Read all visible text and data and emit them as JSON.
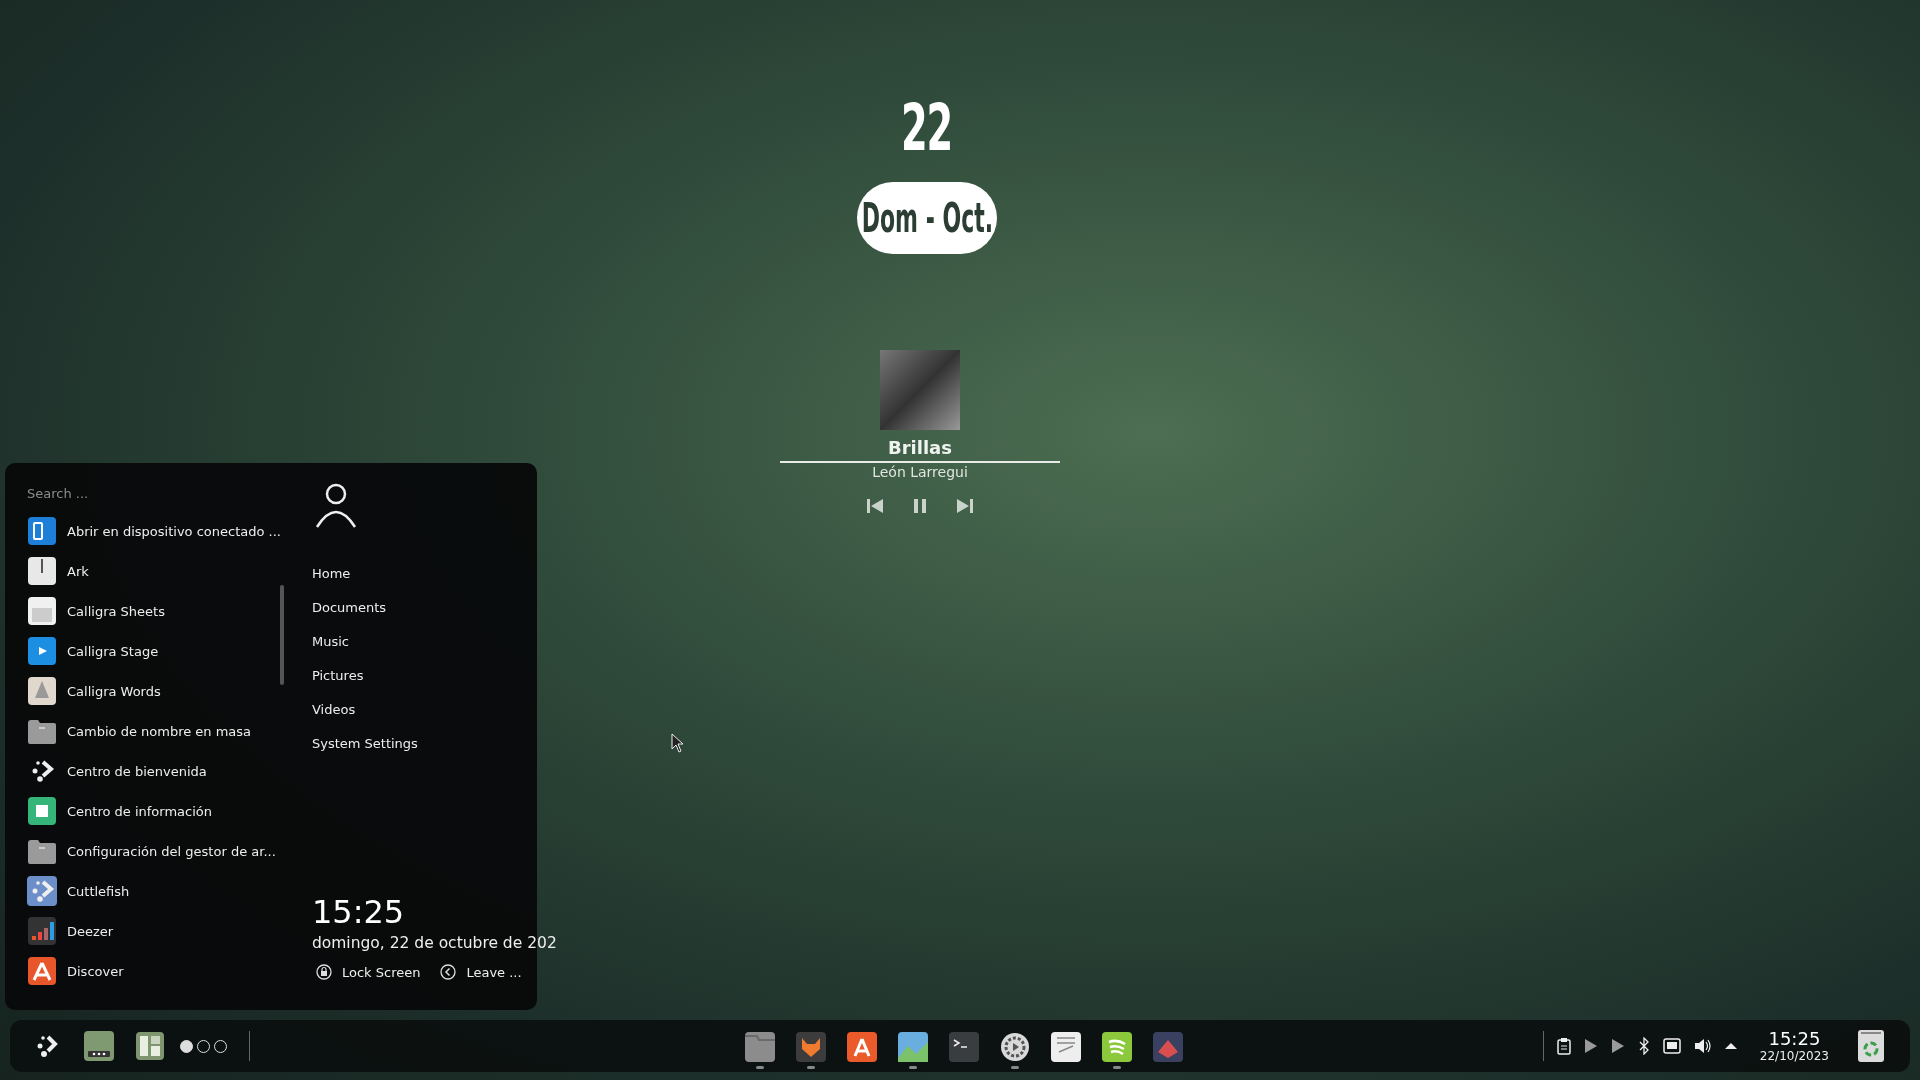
{
  "date_widget": {
    "day": "22",
    "weekday_month": "Dom - Oct."
  },
  "media_player": {
    "title": "Brillas",
    "artist": "León Larregui",
    "playing": true
  },
  "menu": {
    "search": {
      "placeholder": "Search ..."
    },
    "apps": [
      {
        "label": "Abrir en dispositivo conectado ..."
      },
      {
        "label": "Ark"
      },
      {
        "label": "Calligra Sheets"
      },
      {
        "label": "Calligra Stage"
      },
      {
        "label": "Calligra Words"
      },
      {
        "label": "Cambio de nombre en masa"
      },
      {
        "label": "Centro de bienvenida"
      },
      {
        "label": "Centro de información"
      },
      {
        "label": "Configuración del gestor de ar..."
      },
      {
        "label": "Cuttlefish"
      },
      {
        "label": "Deezer"
      },
      {
        "label": "Discover"
      }
    ],
    "places": [
      "Home",
      "Documents",
      "Music",
      "Pictures",
      "Videos",
      "System Settings"
    ],
    "time": "15:25",
    "date": "domingo, 22 de octubre de 202",
    "actions": [
      {
        "kind": "lock",
        "label": "Lock Screen"
      },
      {
        "kind": "leave",
        "label": "Leave ..."
      }
    ]
  },
  "taskbar": {
    "desktops": [
      {
        "selected": true
      },
      {
        "selected": false
      },
      {
        "selected": false
      }
    ],
    "tasks": [
      {
        "running": true
      },
      {
        "running": true
      },
      {
        "running": false
      },
      {
        "running": true
      },
      {
        "running": false
      },
      {
        "running": true
      },
      {
        "running": false
      },
      {
        "running": true
      },
      {
        "running": false
      }
    ],
    "clock": {
      "time": "15:25",
      "date": "22/10/2023"
    }
  }
}
